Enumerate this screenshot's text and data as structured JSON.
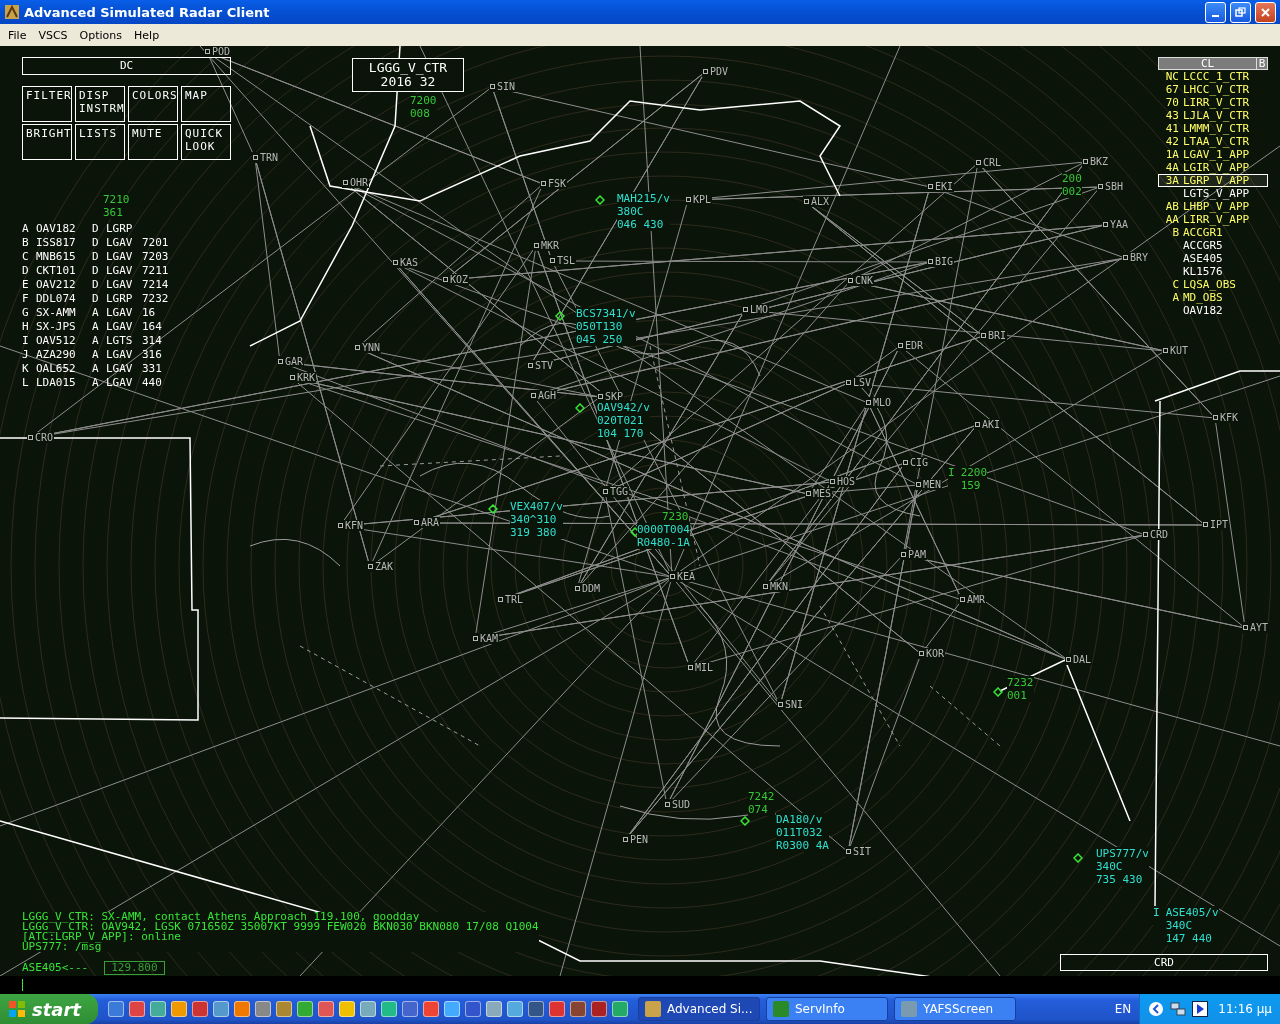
{
  "window": {
    "title": "Advanced Simulated Radar Client"
  },
  "menu": [
    "File",
    "VSCS",
    "Options",
    "Help"
  ],
  "dcb": {
    "header": "DC",
    "buttons": [
      {
        "lines": [
          "FILTER"
        ]
      },
      {
        "lines": [
          "DISP",
          "INSTRM"
        ]
      },
      {
        "lines": [
          "COLORS"
        ]
      },
      {
        "lines": [
          "MAP"
        ]
      },
      {
        "lines": [
          "BRIGHT"
        ]
      },
      {
        "lines": [
          "LISTS"
        ]
      },
      {
        "lines": [
          "MUTE"
        ]
      },
      {
        "lines": [
          "QUICK",
          "LOOK"
        ]
      }
    ]
  },
  "station": {
    "callsign": "LGGG_V_CTR",
    "info": "2016 32"
  },
  "fixes": [
    "POD",
    "SIN",
    "PDV",
    "TRN",
    "OHR",
    "FSK",
    "KPL",
    "ALX",
    "CRL",
    "BKZ",
    "EKI",
    "SBH",
    "YAA",
    "BRY",
    "KAS",
    "MKR",
    "TSL",
    "KOZ",
    "CNK",
    "BIG",
    "LMO",
    "EDR",
    "BRI",
    "KUT",
    "GAR",
    "KRK",
    "YNN",
    "STV",
    "AGH",
    "SKP",
    "LSV",
    "MLO",
    "AKI",
    "KFK",
    "CRO",
    "TGG",
    "KFN",
    "ARA",
    "ZAK",
    "KEA",
    "MES",
    "HOS",
    "CIG",
    "MEN",
    "MKN",
    "DDM",
    "AMR",
    "TRL",
    "KAM",
    "KOR",
    "MIL",
    "DAL",
    "IPT",
    "CRD",
    "AYT",
    "SNI",
    "SUD",
    "PEN",
    "SIT",
    "PAM"
  ],
  "data_blocks": [
    {
      "kind": "untracked",
      "lines": [
        "7200",
        "008"
      ]
    },
    {
      "kind": "untracked",
      "lines": [
        "7210",
        "361"
      ]
    },
    {
      "kind": "tracked",
      "lines": [
        "MAH215/v",
        "380C",
        "046 430"
      ]
    },
    {
      "kind": "tracked",
      "lines": [
        "BCS7341/v",
        "050T130",
        "045 250"
      ]
    },
    {
      "kind": "tracked",
      "lines": [
        "OAV942/v",
        "020T021",
        "104 170"
      ]
    },
    {
      "kind": "tracked",
      "lines": [
        "VEX407/v",
        "340^310",
        "319 380"
      ]
    },
    {
      "kind": "untracked",
      "lines": [
        "7230"
      ]
    },
    {
      "kind": "tracked",
      "lines": [
        "0000T004",
        "R0480-1A"
      ]
    },
    {
      "kind": "untracked",
      "lines": [
        "200",
        "002"
      ]
    },
    {
      "kind": "untracked",
      "marker": "I",
      "lines": [
        "2200",
        "159"
      ]
    },
    {
      "kind": "untracked",
      "lines": [
        "7232",
        "001"
      ]
    },
    {
      "kind": "untracked",
      "lines": [
        "7242",
        "074"
      ]
    },
    {
      "kind": "tracked",
      "lines": [
        "DA180/v",
        "011T032",
        "R0300 4A"
      ]
    },
    {
      "kind": "tracked",
      "lines": [
        "UPS777/v",
        "340C",
        "735 430"
      ]
    },
    {
      "kind": "tracked",
      "marker": "I",
      "lines": [
        "ASE405/v",
        "340C",
        "147 440"
      ]
    }
  ],
  "flight_list": [
    {
      "letter": "A",
      "callsign": "OAV182",
      "rule": "D",
      "airport": "LGRP"
    },
    {
      "letter": "B",
      "callsign": "ISS817",
      "rule": "D",
      "airport": "LGAV",
      "code": "7201"
    },
    {
      "letter": "C",
      "callsign": "MNB615",
      "rule": "D",
      "airport": "LGAV",
      "code": "7203"
    },
    {
      "letter": "D",
      "callsign": "CKT101",
      "rule": "D",
      "airport": "LGAV",
      "code": "7211"
    },
    {
      "letter": "E",
      "callsign": "OAV212",
      "rule": "D",
      "airport": "LGAV",
      "code": "7214"
    },
    {
      "letter": "F",
      "callsign": "DDL074",
      "rule": "D",
      "airport": "LGRP",
      "code": "7232"
    },
    {
      "letter": "G",
      "callsign": "SX-AMM",
      "rule": "A",
      "airport": "LGAV",
      "code": "16"
    },
    {
      "letter": "H",
      "callsign": "SX-JPS",
      "rule": "A",
      "airport": "LGAV",
      "code": "164"
    },
    {
      "letter": "I",
      "callsign": "OAV512",
      "rule": "A",
      "airport": "LGTS",
      "code": "314"
    },
    {
      "letter": "J",
      "callsign": "AZA290",
      "rule": "A",
      "airport": "LGAV",
      "code": "316"
    },
    {
      "letter": "K",
      "callsign": "OAL652",
      "rule": "A",
      "airport": "LGAV",
      "code": "331"
    },
    {
      "letter": "L",
      "callsign": "LDA015",
      "rule": "A",
      "airport": "LGAV",
      "code": "440"
    }
  ],
  "controller_list": {
    "header": "CL",
    "button": "B",
    "rows": [
      {
        "code": "NC",
        "callsign": "LCCC_1_CTR",
        "color": "#ffff66",
        "selected": false
      },
      {
        "code": "67",
        "callsign": "LHCC_V_CTR",
        "color": "#ffff66",
        "selected": false
      },
      {
        "code": "70",
        "callsign": "LIRR_V_CTR",
        "color": "#ffff66",
        "selected": false
      },
      {
        "code": "43",
        "callsign": "LJLA_V_CTR",
        "color": "#ffff66",
        "selected": false
      },
      {
        "code": "41",
        "callsign": "LMMM_V_CTR",
        "color": "#ffff66",
        "selected": false
      },
      {
        "code": "42",
        "callsign": "LTAA_V_CTR",
        "color": "#ffff66",
        "selected": false
      },
      {
        "code": "1A",
        "callsign": "LGAV_1_APP",
        "color": "#ffff66",
        "selected": false
      },
      {
        "code": "4A",
        "callsign": "LGIR_V_APP",
        "color": "#ffff66",
        "selected": false
      },
      {
        "code": "3A",
        "callsign": "LGRP_V_APP",
        "color": "#ffff66",
        "selected": true
      },
      {
        "callsign": "LGTS_V_APP",
        "color": "#ffffff",
        "selected": false
      },
      {
        "code": "AB",
        "callsign": "LHBP_V_APP",
        "color": "#ffff66",
        "selected": false
      },
      {
        "code": "AA",
        "callsign": "LIRR_V_APP",
        "color": "#ffff66",
        "selected": false
      },
      {
        "code": "B",
        "callsign": "ACCGR1",
        "color": "#ffff66",
        "selected": false
      },
      {
        "callsign": "ACCGR5",
        "color": "#ffffff",
        "selected": false
      },
      {
        "callsign": "ASE405",
        "color": "#ffffff",
        "selected": false
      },
      {
        "callsign": "KL1576",
        "color": "#ffffff",
        "selected": false
      },
      {
        "code": "C",
        "callsign": "LQSA_OBS",
        "color": "#ffff66",
        "selected": false
      },
      {
        "code": "A",
        "callsign": "MD_OBS",
        "color": "#ffff66",
        "selected": false
      },
      {
        "callsign": "OAV182",
        "color": "#ffffff",
        "selected": false
      }
    ]
  },
  "messages": [
    "LGGG_V_CTR: SX-AMM, contact Athens Approach 119.100, goodday",
    "LGGG_V_CTR: OAV942, LGSK 071650Z 35007KT 9999 FEW020 BKN030 BKN080 17/08 Q1004",
    "[ATC:LGRP_V_APP]: online",
    "UPS777: /msg"
  ],
  "chat_target": {
    "label": "ASE405<---",
    "frequency": "129.800"
  },
  "crd": {
    "label": "CRD"
  },
  "taskbar": {
    "start": "start",
    "tasks": [
      {
        "label": "Advanced Si...",
        "selected": true
      },
      {
        "label": "ServInfo",
        "selected": false
      },
      {
        "label": "YAFSScreen",
        "selected": false
      }
    ],
    "language": "EN",
    "clock": "11:16 μμ"
  }
}
